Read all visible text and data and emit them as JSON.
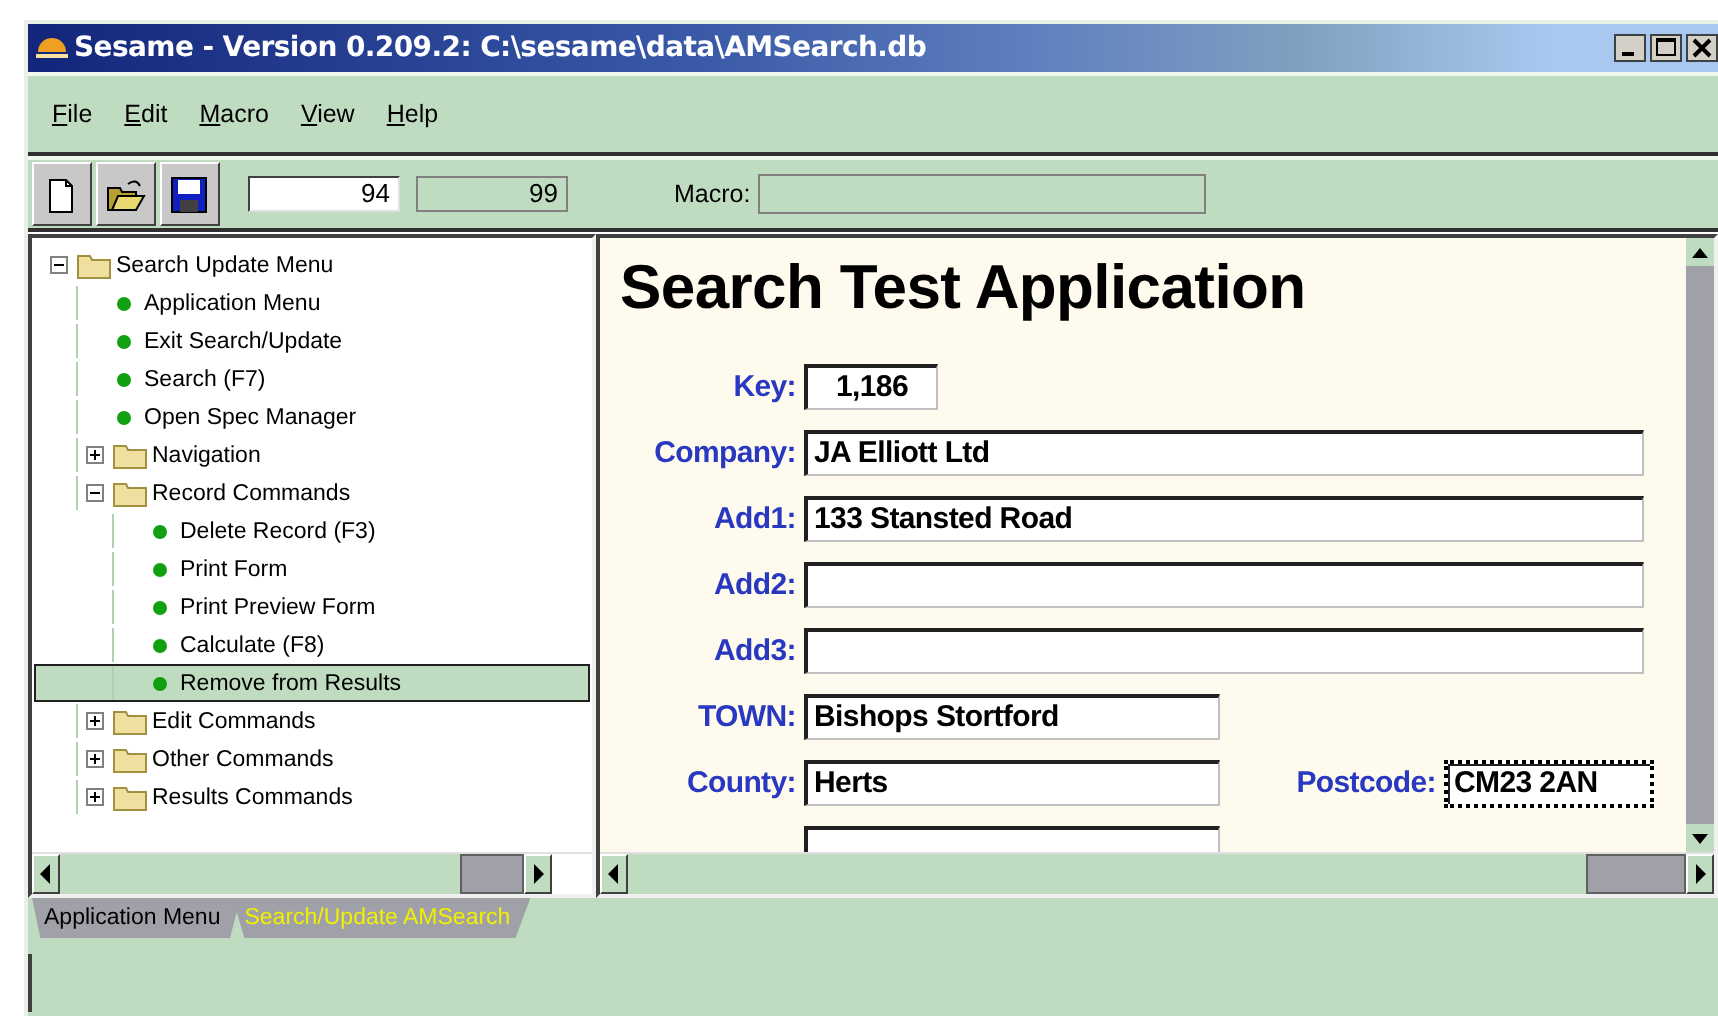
{
  "window": {
    "title": "Sesame - Version 0.209.2: C:\\sesame\\data\\AMSearch.db"
  },
  "menu": [
    {
      "label": "File"
    },
    {
      "label": "Edit"
    },
    {
      "label": "Macro"
    },
    {
      "label": "View"
    },
    {
      "label": "Help"
    }
  ],
  "toolbar": {
    "buttons": [
      {
        "kind": "new"
      },
      {
        "kind": "open"
      },
      {
        "kind": "save"
      }
    ],
    "record": "94",
    "count": "99",
    "macro_label": "Macro:"
  },
  "tree": [
    {
      "label": "Search Update Menu",
      "kind": "folder",
      "expanded": true,
      "selected": false,
      "children": [
        {
          "label": "Application Menu",
          "kind": "command",
          "selected": false
        },
        {
          "label": "Exit Search/Update",
          "kind": "command",
          "selected": false
        },
        {
          "label": "Search (F7)",
          "kind": "command",
          "selected": false
        },
        {
          "label": "Open Spec Manager",
          "kind": "command",
          "selected": false
        },
        {
          "label": "Navigation",
          "kind": "folder",
          "expanded": false,
          "selected": false
        },
        {
          "label": "Record Commands",
          "kind": "folder",
          "expanded": true,
          "selected": false,
          "children": [
            {
              "label": "Delete Record (F3)",
              "kind": "command",
              "selected": false
            },
            {
              "label": "Print Form",
              "kind": "command",
              "selected": false
            },
            {
              "label": "Print Preview Form",
              "kind": "command",
              "selected": false
            },
            {
              "label": "Calculate (F8)",
              "kind": "command",
              "selected": false
            },
            {
              "label": "Remove from Results",
              "kind": "command",
              "selected": true
            }
          ]
        },
        {
          "label": "Edit Commands",
          "kind": "folder",
          "expanded": false,
          "selected": false
        },
        {
          "label": "Other Commands",
          "kind": "folder",
          "expanded": false,
          "selected": false
        },
        {
          "label": "Results Commands",
          "kind": "folder",
          "expanded": false,
          "selected": false
        }
      ]
    }
  ],
  "form": {
    "title": "Search Test Application",
    "rows": [
      {
        "fields": [
          {
            "label": "Key:",
            "value": "1,186",
            "kind": "key",
            "focused": false
          }
        ]
      },
      {
        "fields": [
          {
            "label": "Company:",
            "value": "JA Elliott Ltd",
            "kind": "long",
            "focused": false
          }
        ]
      },
      {
        "fields": [
          {
            "label": "Add1:",
            "value": "133 Stansted Road",
            "kind": "long",
            "focused": false
          }
        ]
      },
      {
        "fields": [
          {
            "label": "Add2:",
            "kind": "long",
            "focused": false
          }
        ]
      },
      {
        "fields": [
          {
            "label": "Add3:",
            "kind": "long",
            "focused": false
          }
        ]
      },
      {
        "fields": [
          {
            "label": "TOWN:",
            "value": "Bishops Stortford",
            "kind": "medium",
            "focused": false
          }
        ]
      },
      {
        "fields": [
          {
            "label": "County:",
            "value": "Herts",
            "kind": "medium",
            "focused": false
          },
          {
            "label": "Postcode:",
            "value": "CM23 2AN",
            "kind": "short",
            "focused": true
          }
        ]
      },
      {
        "fields": [
          {
            "kind": "medium",
            "focused": false
          }
        ]
      }
    ]
  },
  "tabs": [
    {
      "label": "Application Menu",
      "selected": false
    },
    {
      "label": "Search/Update AMSearch",
      "selected": true
    }
  ]
}
